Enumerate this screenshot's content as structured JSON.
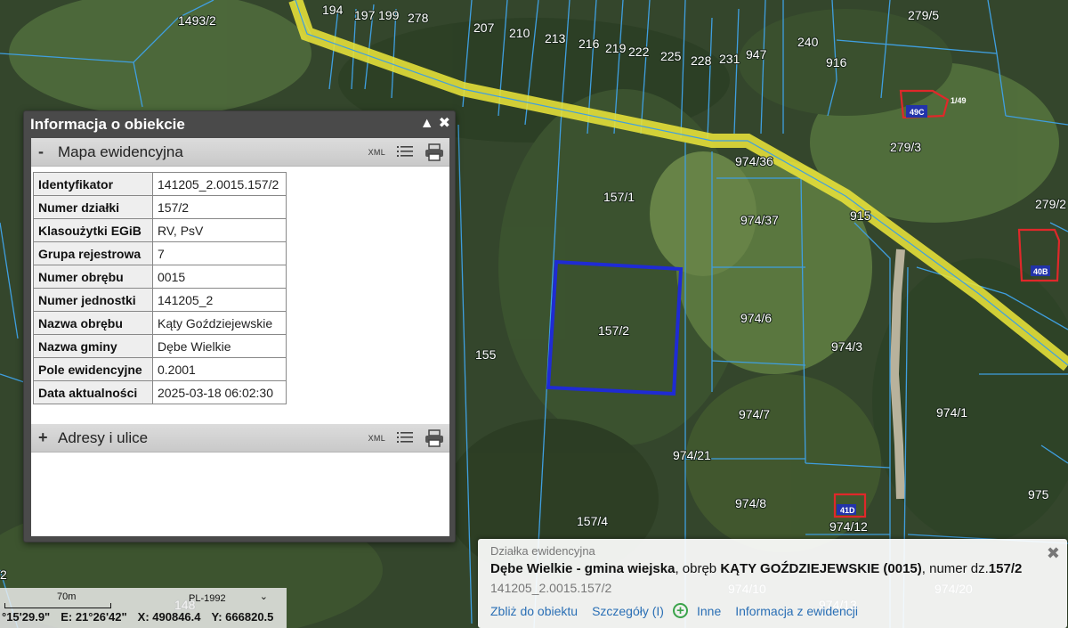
{
  "map": {
    "parcel_labels": [
      "1493/2",
      "194",
      "197",
      "199",
      "278",
      "207",
      "210",
      "213",
      "216",
      "219",
      "222",
      "225",
      "228",
      "231",
      "947",
      "240",
      "916",
      "279/5",
      "279/3",
      "974/36",
      "157/1",
      "974/37",
      "915",
      "279/2",
      "157/2",
      "974/6",
      "974/3",
      "155",
      "974/7",
      "974/1",
      "974/21",
      "974/8",
      "975",
      "157/4",
      "974/12",
      "974/10",
      "974/20",
      "974/13",
      "148",
      "2"
    ],
    "house_labels": [
      "49C",
      "1/49",
      "41D",
      "40B"
    ],
    "highlight_color": "#1f2bd4",
    "road_color": "#e8e23a"
  },
  "info_panel": {
    "title": "Informacja o obiekcie",
    "section1": {
      "sign": "-",
      "title": "Mapa ewidencyjna",
      "xml": "XML",
      "rows": [
        {
          "key": "Identyfikator",
          "value": "141205_2.0015.157/2"
        },
        {
          "key": "Numer działki",
          "value": "157/2"
        },
        {
          "key": "Klasoużytki EGiB",
          "value": "RV, PsV"
        },
        {
          "key": "Grupa rejestrowa",
          "value": "7"
        },
        {
          "key": "Numer obrębu",
          "value": "0015"
        },
        {
          "key": "Numer jednostki",
          "value": "141205_2"
        },
        {
          "key": "Nazwa obrębu",
          "value": "Kąty Goździejewskie"
        },
        {
          "key": "Nazwa gminy",
          "value": "Dębe Wielkie"
        },
        {
          "key": "Pole ewidencyjne",
          "value": "0.2001"
        },
        {
          "key": "Data aktualności",
          "value": "2025-03-18 06:02:30"
        }
      ]
    },
    "section2": {
      "sign": "+",
      "title": "Adresy i ulice",
      "xml": "XML"
    }
  },
  "popup": {
    "subtitle": "Działka ewidencyjna",
    "gmina_bold": "Dębe Wielkie - gmina wiejska",
    "obreb_prefix": ", obręb ",
    "obreb_bold": "KĄTY GOŹDZIEJEWSKIE (0015)",
    "numer_prefix": ", numer dz.",
    "numer_bold": "157/2",
    "identifier": "141205_2.0015.157/2",
    "links": {
      "zoom": "Zbliż do obiektu",
      "details": "Szczegóły (I)",
      "other": "Inne",
      "info": "Informacja z ewidencji"
    }
  },
  "scale": {
    "label": "70m",
    "crs": "PL-1992"
  },
  "coords": {
    "lat": "°15'29.9\"",
    "lon": "E: 21°26'42\"",
    "x": "X: 490846.4",
    "y": "Y: 666820.5"
  }
}
